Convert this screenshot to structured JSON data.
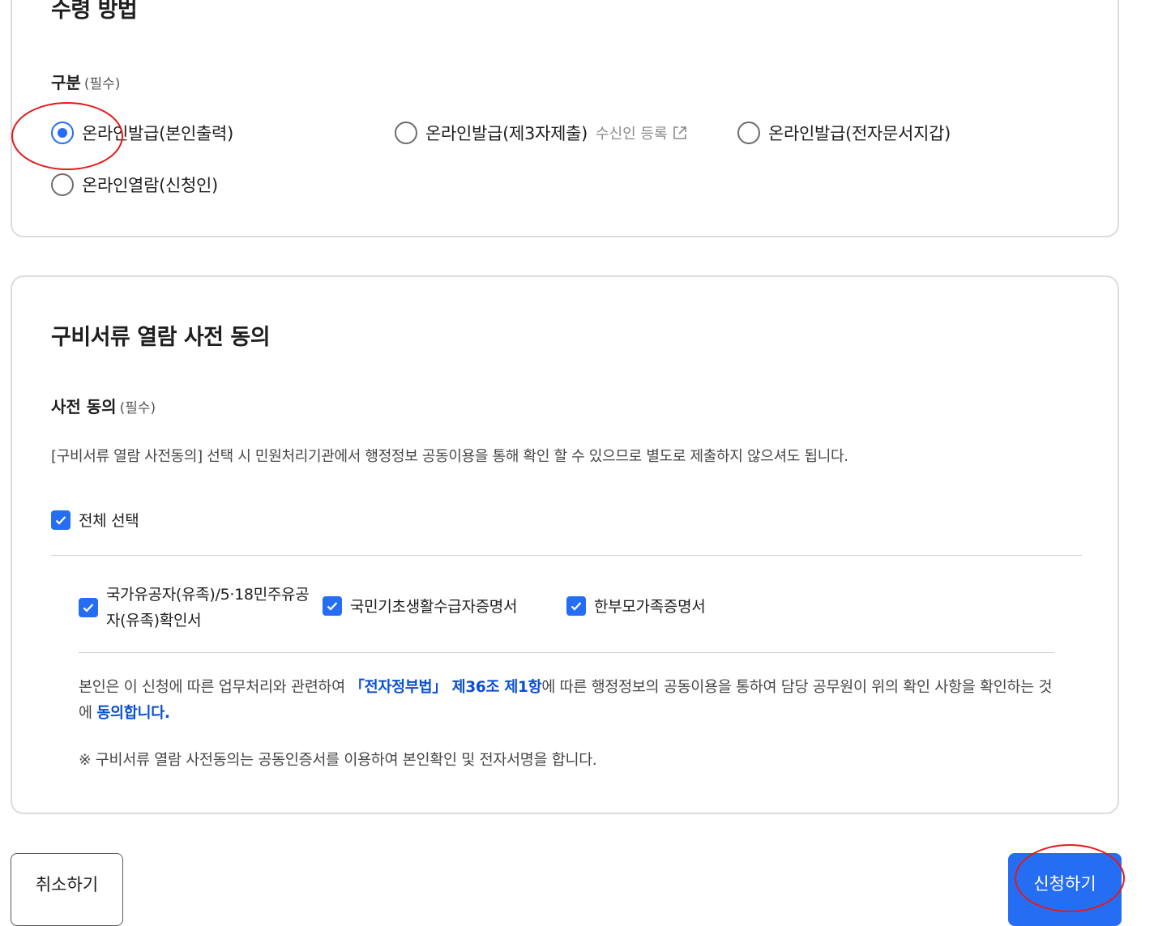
{
  "receipt": {
    "title": "수령 방법",
    "field_label": "구분",
    "required": "(필수)",
    "options": [
      {
        "label": "온라인발급(본인출력)",
        "selected": true
      },
      {
        "label": "온라인발급(제3자제출)",
        "extra": "수신인 등록",
        "selected": false
      },
      {
        "label": "온라인발급(전자문서지갑)",
        "selected": false
      },
      {
        "label": "온라인열람(신청인)",
        "selected": false
      }
    ]
  },
  "consent": {
    "title": "구비서류 열람 사전 동의",
    "field_label": "사전 동의",
    "required": "(필수)",
    "description": "[구비서류 열람 사전동의] 선택 시 민원처리기관에서 행정정보 공동이용을 통해 확인 할 수 있으므로 별도로 제출하지 않으셔도 됩니다.",
    "select_all": "전체 선택",
    "documents": [
      {
        "label_line1": "국가유공자(유족)/5·18민주유공",
        "label_line2": "자(유족)확인서",
        "checked": true
      },
      {
        "label": "국민기초생활수급자증명서",
        "checked": true
      },
      {
        "label": "한부모가족증명서",
        "checked": true
      }
    ],
    "notice_part1": "본인은 이 신청에 따른 업무처리와 관련하여 ",
    "notice_law": "「전자정부법」 제36조 제1항",
    "notice_part2": "에 따른 행정정보의 공동이용을 통하여 담당 공무원이 위의 확인 사항을 확인하는 것에 ",
    "notice_agree": "동의합니다.",
    "note": "※ 구비서류 열람 사전동의는 공동인증서를 이용하여 본인확인 및 전자서명을 합니다."
  },
  "buttons": {
    "cancel": "취소하기",
    "apply": "신청하기"
  },
  "colors": {
    "accent": "#256ef4",
    "link": "#0b50d0",
    "annotation": "#e21b1b",
    "border": "#dcdcdc"
  }
}
